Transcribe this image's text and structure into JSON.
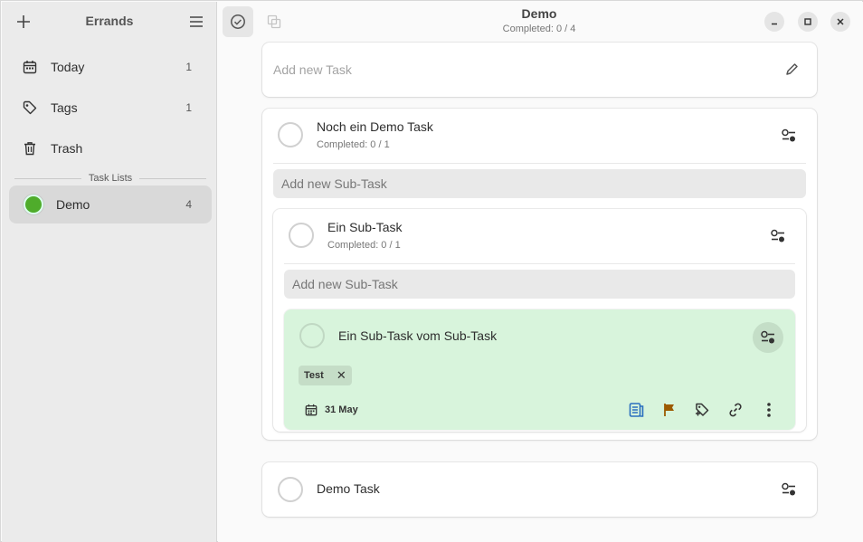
{
  "sidebar": {
    "title": "Errands",
    "items": [
      {
        "label": "Today",
        "count": "1",
        "icon": "calendar-icon"
      },
      {
        "label": "Tags",
        "count": "1",
        "icon": "tag-icon"
      },
      {
        "label": "Trash",
        "count": "",
        "icon": "trash-icon"
      }
    ],
    "section_label": "Task Lists",
    "lists": [
      {
        "label": "Demo",
        "count": "4",
        "color": "#4fac2b"
      }
    ]
  },
  "header": {
    "title": "Demo",
    "subtitle": "Completed: 0 / 4"
  },
  "add_task": {
    "placeholder": "Add new Task"
  },
  "tasks": [
    {
      "title": "Noch ein Demo Task",
      "subtitle": "Completed: 0 / 1",
      "subtask_placeholder": "Add new Sub-Task",
      "subtasks": [
        {
          "title": "Ein Sub-Task",
          "subtitle": "Completed: 0 / 1",
          "subtask_placeholder": "Add new Sub-Task",
          "subtasks": [
            {
              "title": "Ein Sub-Task vom Sub-Task",
              "tag": "Test",
              "due_date": "31 May",
              "highlight_color": "#d8f4dc"
            }
          ]
        }
      ]
    },
    {
      "title": "Demo Task",
      "subtitle": ""
    }
  ],
  "colors": {
    "accent_green": "#4fac2b",
    "notes_icon": "#2a6fbf",
    "flag_icon": "#9c5a00"
  }
}
